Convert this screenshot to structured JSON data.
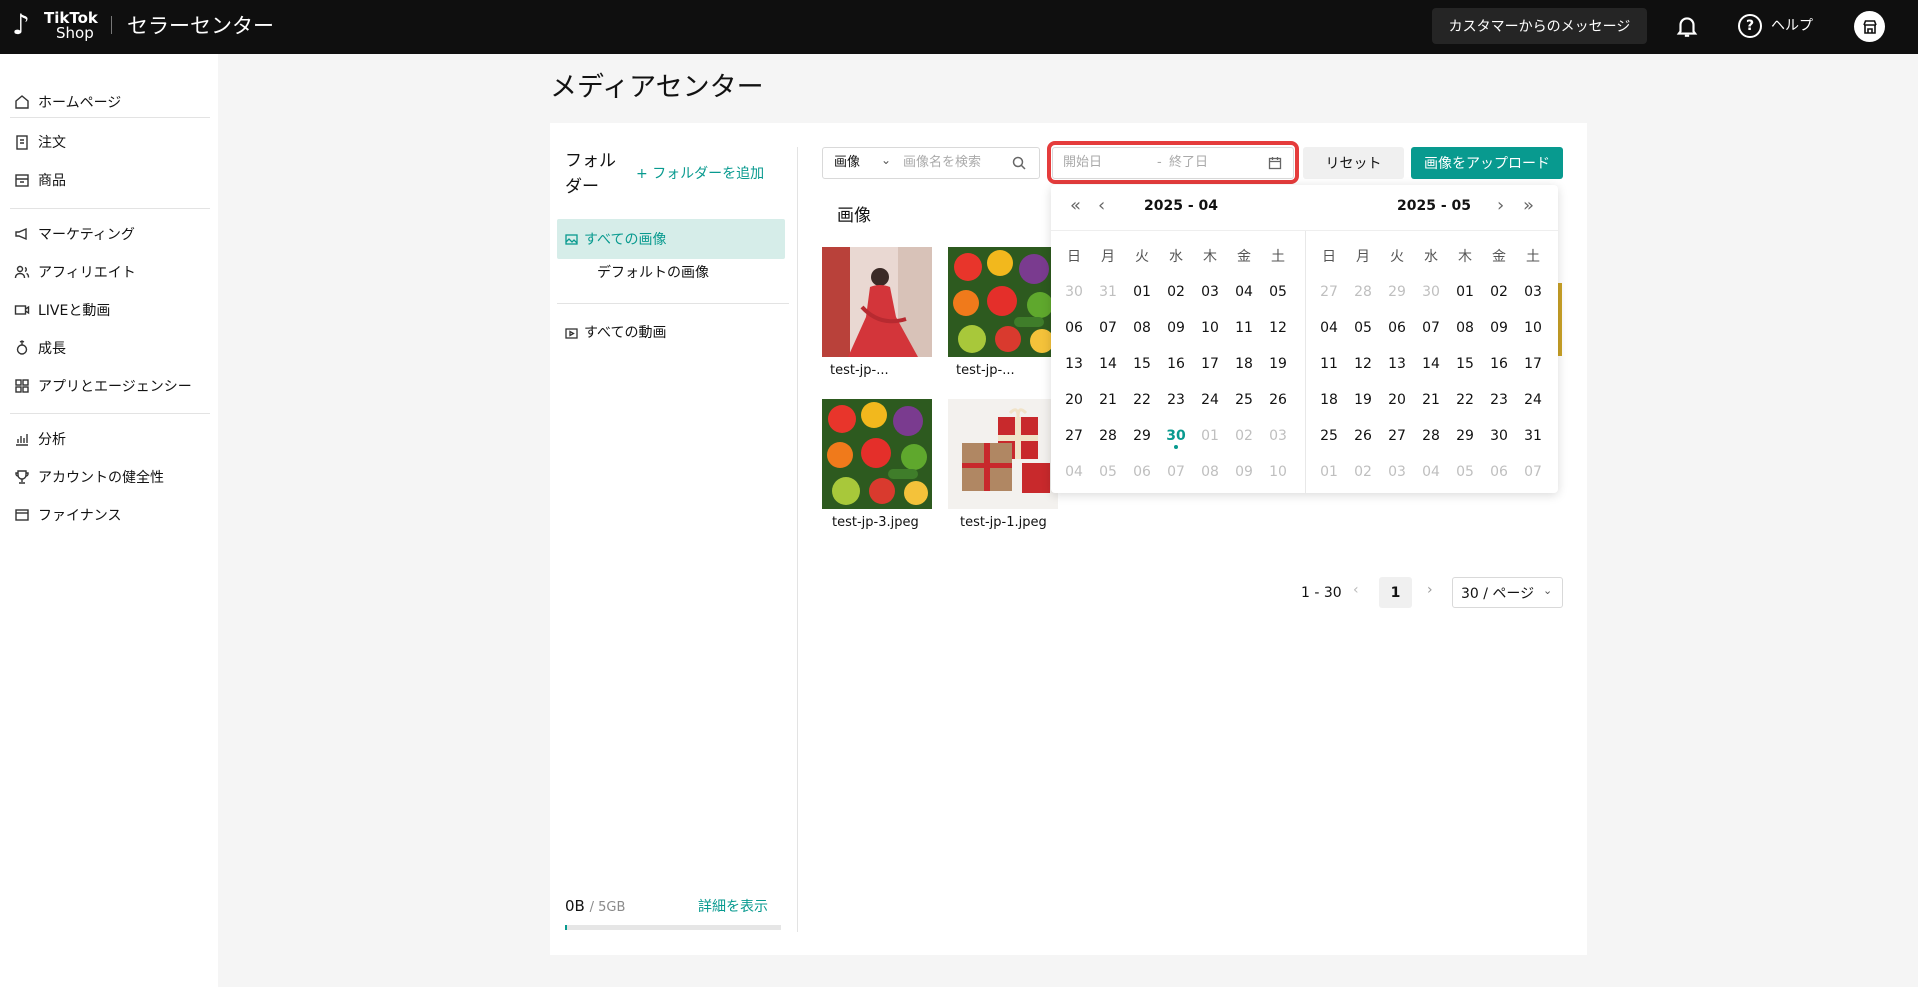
{
  "header": {
    "logo_line1": "TikTok",
    "logo_line2": "Shop",
    "app_title": "セラーセンター",
    "message_button": "カスタマーからのメッセージ",
    "help_label": "ヘルプ",
    "icons": [
      "tiktok-logo-icon",
      "bell-icon",
      "help-icon",
      "store-icon"
    ]
  },
  "sidebar": {
    "items": [
      {
        "label": "ホームページ",
        "icon": "home-icon"
      },
      {
        "label": "注文",
        "icon": "clipboard-icon"
      },
      {
        "label": "商品",
        "icon": "box-icon"
      },
      {
        "label": "マーケティング",
        "icon": "megaphone-icon"
      },
      {
        "label": "アフィリエイト",
        "icon": "people-icon"
      },
      {
        "label": "LIVEと動画",
        "icon": "video-icon"
      },
      {
        "label": "成長",
        "icon": "growth-icon"
      },
      {
        "label": "アプリとエージェンシー",
        "icon": "apps-icon"
      },
      {
        "label": "分析",
        "icon": "chart-icon"
      },
      {
        "label": "アカウントの健全性",
        "icon": "trophy-icon"
      },
      {
        "label": "ファイナンス",
        "icon": "wallet-icon"
      }
    ]
  },
  "page": {
    "title": "メディアセンター"
  },
  "folders": {
    "title": "フォルダー",
    "add_label": "フォルダーを追加",
    "all_images": "すべての画像",
    "default_images": "デフォルトの画像",
    "all_videos": "すべての動画",
    "storage_used": "0B",
    "storage_total": "/ 5GB",
    "storage_fraction": 0.01,
    "details_link": "詳細を表示"
  },
  "toolbar": {
    "type_select": "画像",
    "search_placeholder": "画像名を検索",
    "date_start_placeholder": "開始日",
    "date_separator": "-",
    "date_end_placeholder": "終了日",
    "reset_label": "リセット",
    "upload_label": "画像をアップロード"
  },
  "gallery": {
    "section_title": "画像",
    "images": [
      {
        "name": "test-jp-...",
        "subject": "woman-in-red-dress"
      },
      {
        "name": "test-jp-...",
        "subject": "vegetables"
      },
      {
        "name": "test-jp-3.jpeg",
        "subject": "vegetables"
      },
      {
        "name": "test-jp-1.jpeg",
        "subject": "gift-boxes"
      }
    ]
  },
  "pagination": {
    "range": "1 - 30",
    "current_page": "1",
    "page_size": "30 / ページ"
  },
  "calendar": {
    "weekdays": [
      "日",
      "月",
      "火",
      "水",
      "木",
      "金",
      "土"
    ],
    "left": {
      "title": "2025 - 04",
      "days": [
        {
          "d": "30",
          "m": true
        },
        {
          "d": "31",
          "m": true
        },
        {
          "d": "01"
        },
        {
          "d": "02"
        },
        {
          "d": "03"
        },
        {
          "d": "04"
        },
        {
          "d": "05"
        },
        {
          "d": "06"
        },
        {
          "d": "07"
        },
        {
          "d": "08"
        },
        {
          "d": "09"
        },
        {
          "d": "10"
        },
        {
          "d": "11"
        },
        {
          "d": "12"
        },
        {
          "d": "13"
        },
        {
          "d": "14"
        },
        {
          "d": "15"
        },
        {
          "d": "16"
        },
        {
          "d": "17"
        },
        {
          "d": "18"
        },
        {
          "d": "19"
        },
        {
          "d": "20"
        },
        {
          "d": "21"
        },
        {
          "d": "22"
        },
        {
          "d": "23"
        },
        {
          "d": "24"
        },
        {
          "d": "25"
        },
        {
          "d": "26"
        },
        {
          "d": "27"
        },
        {
          "d": "28"
        },
        {
          "d": "29"
        },
        {
          "d": "30",
          "today": true
        },
        {
          "d": "01",
          "m": true
        },
        {
          "d": "02",
          "m": true
        },
        {
          "d": "03",
          "m": true
        },
        {
          "d": "04",
          "m": true
        },
        {
          "d": "05",
          "m": true
        },
        {
          "d": "06",
          "m": true
        },
        {
          "d": "07",
          "m": true
        },
        {
          "d": "08",
          "m": true
        },
        {
          "d": "09",
          "m": true
        },
        {
          "d": "10",
          "m": true
        }
      ]
    },
    "right": {
      "title": "2025 - 05",
      "days": [
        {
          "d": "27",
          "m": true
        },
        {
          "d": "28",
          "m": true
        },
        {
          "d": "29",
          "m": true
        },
        {
          "d": "30",
          "m": true
        },
        {
          "d": "01"
        },
        {
          "d": "02"
        },
        {
          "d": "03"
        },
        {
          "d": "04"
        },
        {
          "d": "05"
        },
        {
          "d": "06"
        },
        {
          "d": "07"
        },
        {
          "d": "08"
        },
        {
          "d": "09"
        },
        {
          "d": "10"
        },
        {
          "d": "11"
        },
        {
          "d": "12"
        },
        {
          "d": "13"
        },
        {
          "d": "14"
        },
        {
          "d": "15"
        },
        {
          "d": "16"
        },
        {
          "d": "17"
        },
        {
          "d": "18"
        },
        {
          "d": "19"
        },
        {
          "d": "20"
        },
        {
          "d": "21"
        },
        {
          "d": "22"
        },
        {
          "d": "23"
        },
        {
          "d": "24"
        },
        {
          "d": "25"
        },
        {
          "d": "26"
        },
        {
          "d": "27"
        },
        {
          "d": "28"
        },
        {
          "d": "29"
        },
        {
          "d": "30"
        },
        {
          "d": "31"
        },
        {
          "d": "01",
          "m": true
        },
        {
          "d": "02",
          "m": true
        },
        {
          "d": "03",
          "m": true
        },
        {
          "d": "04",
          "m": true
        },
        {
          "d": "05",
          "m": true
        },
        {
          "d": "06",
          "m": true
        },
        {
          "d": "07",
          "m": true
        }
      ]
    }
  },
  "colors": {
    "accent": "#089a8f",
    "topbar": "#0f0f0f",
    "highlight": "#e53c3c"
  }
}
